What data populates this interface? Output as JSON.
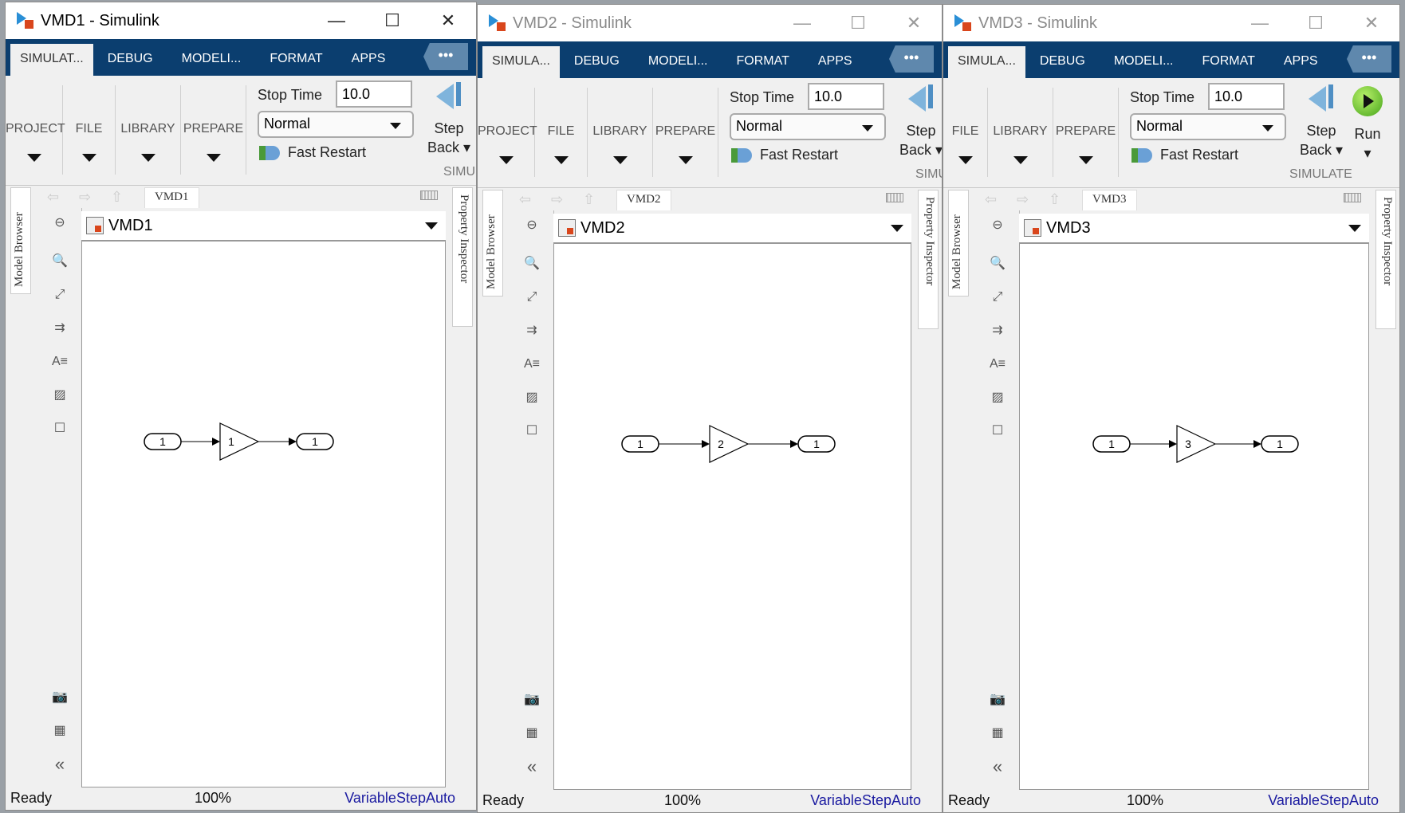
{
  "colors": {
    "tabbar": "#0b3e6f",
    "solver_text": "#1a1aa0",
    "accent_orange": "#d9461c"
  },
  "windows": [
    {
      "title": "VMD1 - Simulink",
      "active": true,
      "window_controls": {
        "minimize": "—",
        "maximize": "☐",
        "close": "✕"
      },
      "tabs": [
        "SIMULAT...",
        "DEBUG",
        "MODELI...",
        "FORMAT",
        "APPS"
      ],
      "more": "•••",
      "groups": [
        "PROJECT",
        "FILE",
        "LIBRARY",
        "PREPARE"
      ],
      "stop_time_label": "Stop Time",
      "stop_time": "10.0",
      "sim_mode": "Normal",
      "fast_restart": "Fast Restart",
      "step_back": [
        "Step",
        "Back ▾"
      ],
      "run": null,
      "section_label": "SIMUL",
      "breadcrumb": "VMD1",
      "model_address": "VMD1",
      "model_browser": "Model Browser",
      "property_inspector": "Property Inspector",
      "blocks": {
        "inport": "1",
        "gain": "1",
        "outport": "1"
      },
      "status": {
        "state": "Ready",
        "zoom": "100%",
        "solver": "VariableStepAuto"
      }
    },
    {
      "title": "VMD2 - Simulink",
      "active": false,
      "window_controls": {
        "minimize": "—",
        "maximize": "☐",
        "close": "✕"
      },
      "tabs": [
        "SIMULA...",
        "DEBUG",
        "MODELI...",
        "FORMAT",
        "APPS"
      ],
      "more": "•••",
      "groups": [
        "PROJECT",
        "FILE",
        "LIBRARY",
        "PREPARE"
      ],
      "stop_time_label": "Stop Time",
      "stop_time": "10.0",
      "sim_mode": "Normal",
      "fast_restart": "Fast Restart",
      "step_back": [
        "Step",
        "Back ▾"
      ],
      "run": null,
      "section_label": "SIMUL",
      "breadcrumb": "VMD2",
      "model_address": "VMD2",
      "model_browser": "Model Browser",
      "property_inspector": "Property Inspector",
      "blocks": {
        "inport": "1",
        "gain": "2",
        "outport": "1"
      },
      "status": {
        "state": "Ready",
        "zoom": "100%",
        "solver": "VariableStepAuto"
      }
    },
    {
      "title": "VMD3 - Simulink",
      "active": false,
      "window_controls": {
        "minimize": "—",
        "maximize": "☐",
        "close": "✕"
      },
      "tabs": [
        "SIMULA...",
        "DEBUG",
        "MODELI...",
        "FORMAT",
        "APPS"
      ],
      "more": "•••",
      "groups": [
        "FILE",
        "LIBRARY",
        "PREPARE"
      ],
      "stop_time_label": "Stop Time",
      "stop_time": "10.0",
      "sim_mode": "Normal",
      "fast_restart": "Fast Restart",
      "step_back": [
        "Step",
        "Back ▾"
      ],
      "run": [
        "Run",
        "▾"
      ],
      "section_label": "SIMULATE",
      "breadcrumb": "VMD3",
      "model_address": "VMD3",
      "model_browser": "Model Browser",
      "property_inspector": "Property Inspector",
      "blocks": {
        "inport": "1",
        "gain": "3",
        "outport": "1"
      },
      "status": {
        "state": "Ready",
        "zoom": "100%",
        "solver": "VariableStepAuto"
      }
    }
  ]
}
